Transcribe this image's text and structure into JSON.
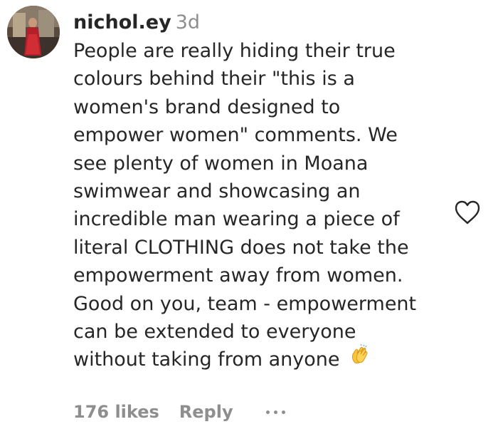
{
  "comment": {
    "username": "nichol.ey",
    "timestamp": "3d",
    "text_lines": [
      "People are really hiding their true",
      "colours behind their \"this is a",
      "women's brand designed to",
      "empower women\" comments. We",
      "see plenty of women in Moana",
      "swimwear and showcasing an",
      "incredible man wearing a piece of",
      "literal CLOTHING does not take the",
      "empowerment away from women.",
      "Good on you, team - empowerment",
      "can be extended to everyone",
      "without taking from anyone"
    ],
    "emoji": "clapping-hands-icon",
    "likes": "176 likes",
    "reply_label": "Reply",
    "more_icon": "more-options-icon",
    "like_icon": "heart-icon"
  },
  "colors": {
    "text": "#262626",
    "secondary": "#8e8e8e",
    "clap": "#f7c43b"
  }
}
